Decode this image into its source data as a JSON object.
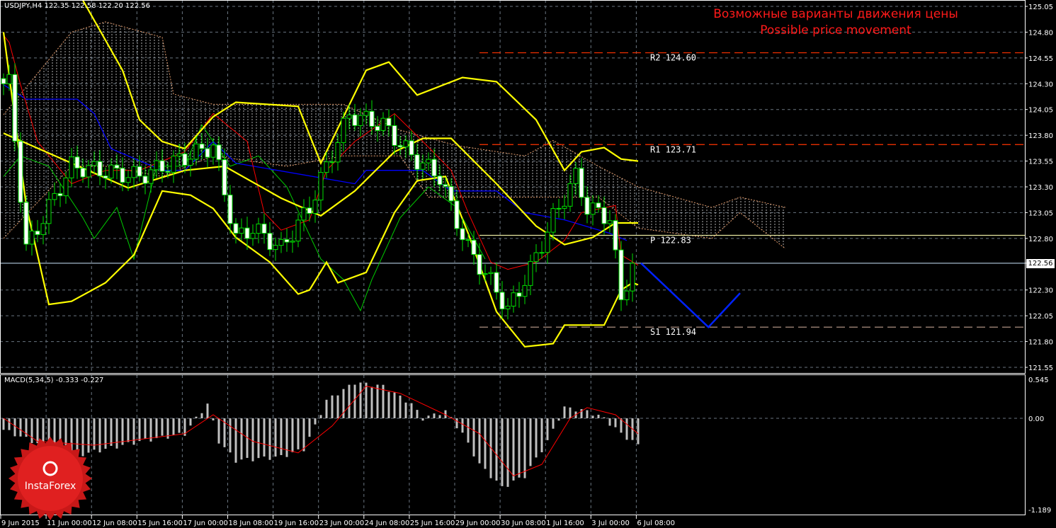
{
  "header": {
    "symbol_line": "USDJPY,H4  122.35 122.58 122.20 122.56"
  },
  "annotation": {
    "ru": "Возможные варианты движения цены",
    "en": "Possible price movement"
  },
  "logo": {
    "text": "InstaForex"
  },
  "macd_header": "MACD(5,34,5) -0.333 -0.227",
  "colors": {
    "bull_outline": "#00e000",
    "bear_fill": "#ffffff",
    "bands": "#ffff00",
    "tenkan": "#ff0000",
    "kijun": "#0000ff",
    "chikou": "#00cc00",
    "forecast": "#0022ff",
    "resistance": "#ff3300",
    "support": "#c0a090",
    "pivot": "#e8e8a0",
    "grid": "#6a7580"
  },
  "chart_data": {
    "type": "candlestick",
    "symbol": "USDJPY",
    "timeframe": "H4",
    "ylim": [
      121.55,
      125.05
    ],
    "y_ticks": [
      "125.05",
      "124.80",
      "124.55",
      "124.30",
      "124.05",
      "123.80",
      "123.55",
      "123.30",
      "123.05",
      "122.80",
      "122.56",
      "122.30",
      "122.05",
      "121.80",
      "121.55"
    ],
    "current_price": "122.56",
    "x_ticks": [
      "9 Jun 2015",
      "11 Jun 00:00",
      "12 Jun 08:00",
      "15 Jun 16:00",
      "17 Jun 00:00",
      "18 Jun 08:00",
      "19 Jun 16:00",
      "23 Jun 00:00",
      "24 Jun 08:00",
      "25 Jun 16:00",
      "29 Jun 00:00",
      "30 Jun 08:00",
      "1 Jul 16:00",
      "3 Jul 00:00",
      "6 Jul 08:00"
    ],
    "close_keypoints": [
      [
        0,
        124.3
      ],
      [
        1,
        124.3
      ],
      [
        4,
        122.7
      ],
      [
        12,
        123.5
      ],
      [
        24,
        123.4
      ],
      [
        37,
        123.7
      ],
      [
        41,
        122.8
      ],
      [
        44,
        122.9
      ],
      [
        49,
        122.7
      ],
      [
        54,
        123.1
      ],
      [
        57,
        123.5
      ],
      [
        61,
        124.0
      ],
      [
        67,
        123.9
      ],
      [
        72,
        123.6
      ],
      [
        77,
        123.4
      ],
      [
        79,
        123.1
      ],
      [
        82,
        122.7
      ],
      [
        87,
        122.3
      ],
      [
        89,
        122.1
      ],
      [
        93,
        122.5
      ],
      [
        97,
        123.0
      ],
      [
        101,
        123.4
      ],
      [
        103,
        123.1
      ],
      [
        107,
        123.0
      ],
      [
        109,
        122.2
      ],
      [
        111,
        122.56
      ]
    ],
    "bollinger": {
      "upper": [
        [
          14,
          125.11
        ],
        [
          21,
          124.43
        ],
        [
          24,
          123.95
        ],
        [
          28,
          123.74
        ],
        [
          32,
          123.67
        ],
        [
          37,
          123.98
        ],
        [
          41,
          124.12
        ],
        [
          52,
          124.08
        ],
        [
          56,
          123.53
        ],
        [
          64,
          124.43
        ],
        [
          68,
          124.51
        ],
        [
          73,
          124.19
        ],
        [
          81,
          124.36
        ],
        [
          87,
          124.32
        ],
        [
          94,
          123.95
        ],
        [
          99,
          123.46
        ],
        [
          102,
          123.64
        ],
        [
          106,
          123.68
        ],
        [
          109,
          123.57
        ],
        [
          112,
          123.55
        ]
      ],
      "middle": [
        [
          0,
          123.82
        ],
        [
          12,
          123.53
        ],
        [
          22,
          123.29
        ],
        [
          32,
          123.46
        ],
        [
          39,
          123.5
        ],
        [
          49,
          123.19
        ],
        [
          56,
          123.02
        ],
        [
          62,
          123.26
        ],
        [
          69,
          123.64
        ],
        [
          74,
          123.77
        ],
        [
          79,
          123.77
        ],
        [
          87,
          123.33
        ],
        [
          94,
          122.92
        ],
        [
          99,
          122.74
        ],
        [
          104,
          122.81
        ],
        [
          108,
          122.95
        ],
        [
          112,
          122.95
        ]
      ],
      "lower": [
        [
          0,
          124.8
        ],
        [
          4,
          123.12
        ],
        [
          8,
          122.16
        ],
        [
          12,
          122.19
        ],
        [
          18,
          122.37
        ],
        [
          23,
          122.64
        ],
        [
          28,
          123.26
        ],
        [
          33,
          123.22
        ],
        [
          37,
          123.09
        ],
        [
          41,
          122.81
        ],
        [
          47,
          122.57
        ],
        [
          52,
          122.26
        ],
        [
          54,
          122.3
        ],
        [
          57,
          122.57
        ],
        [
          59,
          122.37
        ],
        [
          64,
          122.47
        ],
        [
          69,
          123.05
        ],
        [
          73,
          123.36
        ],
        [
          78,
          123.4
        ],
        [
          82,
          122.85
        ],
        [
          87,
          122.09
        ],
        [
          92,
          121.75
        ],
        [
          97,
          121.78
        ],
        [
          99,
          121.96
        ],
        [
          106,
          121.96
        ],
        [
          109,
          122.3
        ],
        [
          111,
          122.37
        ],
        [
          112,
          122.35
        ]
      ]
    },
    "ichimoku": {
      "tenkan": [
        [
          0,
          124.77
        ],
        [
          1,
          124.7
        ],
        [
          3,
          124.29
        ],
        [
          6,
          123.74
        ],
        [
          12,
          123.33
        ],
        [
          18,
          123.46
        ],
        [
          24,
          123.46
        ],
        [
          32,
          123.64
        ],
        [
          37,
          124.01
        ],
        [
          43,
          123.74
        ],
        [
          46,
          123.05
        ],
        [
          49,
          122.88
        ],
        [
          54,
          122.98
        ],
        [
          57,
          123.46
        ],
        [
          62,
          123.74
        ],
        [
          69,
          124.01
        ],
        [
          74,
          123.74
        ],
        [
          79,
          123.46
        ],
        [
          82,
          123.05
        ],
        [
          86,
          122.57
        ],
        [
          89,
          122.5
        ],
        [
          94,
          122.57
        ],
        [
          99,
          122.78
        ],
        [
          102,
          123.05
        ],
        [
          108,
          123.12
        ],
        [
          109,
          122.64
        ],
        [
          112,
          122.54
        ]
      ],
      "kijun": [
        [
          0,
          124.29
        ],
        [
          4,
          124.15
        ],
        [
          13,
          124.15
        ],
        [
          16,
          124.01
        ],
        [
          19,
          123.67
        ],
        [
          28,
          123.46
        ],
        [
          32,
          123.46
        ],
        [
          37,
          123.74
        ],
        [
          41,
          123.53
        ],
        [
          62,
          123.33
        ],
        [
          64,
          123.46
        ],
        [
          74,
          123.46
        ],
        [
          79,
          123.26
        ],
        [
          87,
          123.26
        ],
        [
          92,
          123.05
        ],
        [
          99,
          122.98
        ],
        [
          107,
          122.85
        ],
        [
          110,
          122.78
        ]
      ],
      "chikou": [
        [
          0,
          123.4
        ],
        [
          3,
          123.6
        ],
        [
          8,
          123.5
        ],
        [
          14,
          123.0
        ],
        [
          16,
          122.8
        ],
        [
          20,
          123.1
        ],
        [
          23,
          122.6
        ],
        [
          27,
          123.5
        ],
        [
          32,
          123.5
        ],
        [
          35,
          123.9
        ],
        [
          40,
          123.5
        ],
        [
          45,
          123.6
        ],
        [
          50,
          123.3
        ],
        [
          56,
          122.6
        ],
        [
          60,
          122.4
        ],
        [
          63,
          122.1
        ],
        [
          65,
          122.4
        ],
        [
          70,
          123.0
        ],
        [
          75,
          123.3
        ],
        [
          80,
          123.1
        ],
        [
          85,
          122.6
        ]
      ],
      "cloud_upper": [
        [
          0,
          124.0
        ],
        [
          12,
          124.8
        ],
        [
          18,
          124.9
        ],
        [
          28,
          124.75
        ],
        [
          30,
          124.2
        ],
        [
          37,
          124.1
        ],
        [
          60,
          124.1
        ],
        [
          70,
          123.85
        ],
        [
          80,
          123.7
        ],
        [
          92,
          123.6
        ],
        [
          97,
          123.75
        ],
        [
          105,
          123.5
        ],
        [
          112,
          123.3
        ],
        [
          125,
          123.1
        ],
        [
          130,
          123.2
        ],
        [
          138,
          123.1
        ]
      ],
      "cloud_lower": [
        [
          0,
          122.8
        ],
        [
          12,
          123.5
        ],
        [
          18,
          123.5
        ],
        [
          28,
          123.4
        ],
        [
          37,
          123.6
        ],
        [
          50,
          123.5
        ],
        [
          60,
          123.6
        ],
        [
          70,
          123.6
        ],
        [
          75,
          123.2
        ],
        [
          85,
          123.2
        ],
        [
          95,
          123.2
        ],
        [
          105,
          123.2
        ],
        [
          112,
          122.9
        ],
        [
          125,
          122.8
        ],
        [
          130,
          123.05
        ],
        [
          138,
          122.7
        ]
      ]
    },
    "levels": [
      {
        "label": "R2 124.60",
        "value": 124.6,
        "kind": "resistance"
      },
      {
        "label": "R1 123.71",
        "value": 123.71,
        "kind": "resistance"
      },
      {
        "label": "P 122.83",
        "value": 122.83,
        "kind": "pivot"
      },
      {
        "label": "S1 121.94",
        "value": 121.94,
        "kind": "support"
      }
    ],
    "forecast_path": [
      [
        112.5,
        122.56
      ],
      [
        124.4,
        121.94
      ],
      [
        130,
        122.27
      ]
    ],
    "macd": {
      "params": "5,34,5",
      "ylim": [
        -1.189,
        0.545
      ],
      "y_ticks": [
        "0.545",
        "0.00",
        "-1.189"
      ],
      "histogram_keypoints": [
        [
          0,
          -0.15
        ],
        [
          12,
          -0.5
        ],
        [
          18,
          -0.4
        ],
        [
          24,
          -0.3
        ],
        [
          32,
          -0.2
        ],
        [
          36,
          0.2
        ],
        [
          38,
          -0.3
        ],
        [
          41,
          -0.55
        ],
        [
          49,
          -0.5
        ],
        [
          53,
          -0.4
        ],
        [
          55,
          -0.1
        ],
        [
          57,
          0.25
        ],
        [
          62,
          0.5
        ],
        [
          67,
          0.45
        ],
        [
          72,
          0.2
        ],
        [
          74,
          0.0
        ],
        [
          78,
          0.1
        ],
        [
          81,
          -0.2
        ],
        [
          84,
          -0.6
        ],
        [
          88,
          -0.9
        ],
        [
          92,
          -0.75
        ],
        [
          96,
          -0.3
        ],
        [
          99,
          0.15
        ],
        [
          103,
          0.1
        ],
        [
          106,
          0.0
        ],
        [
          109,
          -0.2
        ],
        [
          112,
          -0.35
        ]
      ],
      "signal_keypoints": [
        [
          0,
          0.0
        ],
        [
          6,
          -0.3
        ],
        [
          16,
          -0.35
        ],
        [
          32,
          -0.2
        ],
        [
          37,
          0.05
        ],
        [
          44,
          -0.3
        ],
        [
          52,
          -0.45
        ],
        [
          58,
          -0.1
        ],
        [
          64,
          0.45
        ],
        [
          70,
          0.35
        ],
        [
          78,
          0.05
        ],
        [
          84,
          -0.2
        ],
        [
          90,
          -0.75
        ],
        [
          95,
          -0.6
        ],
        [
          100,
          0.0
        ],
        [
          103,
          0.15
        ],
        [
          108,
          0.05
        ],
        [
          112,
          -0.2
        ]
      ]
    }
  }
}
